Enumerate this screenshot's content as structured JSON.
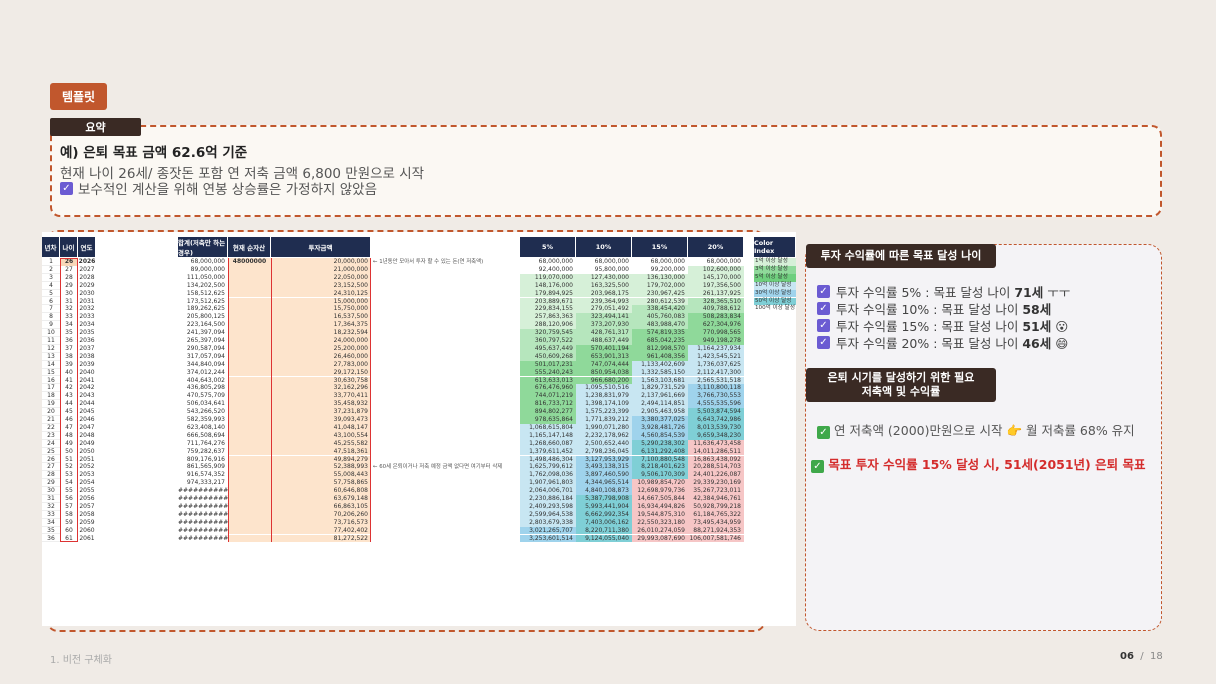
{
  "template_tag": "템플릿",
  "summary": {
    "tab": "요약",
    "line1": "예) 은퇴 목표 금액 62.6억 기준",
    "line2": "현재 나이 26세/ 종잣돈 포함 연 저축 금액 6,800 만원으로 시작",
    "line3": "보수적인 계산을 위해 연봉 상승률은 가정하지 않았음"
  },
  "sheet": {
    "headers": {
      "year_no": "년차",
      "age": "나이",
      "year": "연도",
      "total": "합계(저축만 하는 경우)",
      "current": "현재 순자산",
      "invest": "투자금액",
      "r5": "5%",
      "r10": "10%",
      "r15": "15%",
      "r20": "20%",
      "color_index": "Color Index"
    },
    "first_current": "48000000",
    "note1": "← 1년동안 모아서 투자 할 수 있는 돈(연 저축액)",
    "note2": "← 60세 은퇴이거나 저축 예정 금액 없다면 여기부터 삭제",
    "color_index": [
      "1억 이상 달성",
      "3억 이상 달성",
      "5억 이상 달성",
      "10억 이상 달성",
      "30억 이상 달성",
      "50억 이상 달성",
      "100억 이상 달성"
    ],
    "total_col": [
      "68,000,000",
      "89,000,000",
      "111,050,000",
      "134,202,500",
      "158,512,625",
      "173,512,625",
      "189,262,625",
      "205,800,125",
      "223,164,500",
      "241,397,094",
      "265,397,094",
      "290,587,094",
      "317,057,094",
      "344,840,094",
      "374,012,244",
      "404,643,002",
      "436,805,298",
      "470,575,709",
      "506,034,641",
      "543,266,520",
      "582,359,993",
      "623,408,140",
      "666,508,694",
      "711,764,276",
      "759,282,637",
      "809,176,916",
      "861,565,909",
      "916,574,352",
      "974,333,217",
      "##########",
      "##########",
      "##########",
      "##########",
      "##########",
      "##########",
      "##########"
    ],
    "invest_col": [
      "20,000,000",
      "21,000,000",
      "22,050,000",
      "23,152,500",
      "24,310,125",
      "15,000,000",
      "15,750,000",
      "16,537,500",
      "17,364,375",
      "18,232,594",
      "24,000,000",
      "25,200,000",
      "26,460,000",
      "27,783,000",
      "29,172,150",
      "30,630,758",
      "32,162,296",
      "33,770,411",
      "35,458,932",
      "37,231,879",
      "39,093,473",
      "41,048,147",
      "43,100,554",
      "45,255,582",
      "47,518,361",
      "49,894,279",
      "52,388,993",
      "55,008,443",
      "57,758,865",
      "60,646,808",
      "63,679,148",
      "66,863,105",
      "70,206,260",
      "73,716,573",
      "77,402,402",
      "81,272,522"
    ],
    "r5_col": [
      "68,000,000",
      "92,400,000",
      "119,070,000",
      "148,176,000",
      "179,894,925",
      "203,889,671",
      "229,834,155",
      "257,863,363",
      "288,120,906",
      "320,759,545",
      "360,797,522",
      "495,637,449",
      "450,609,268",
      "501,017,231",
      "555,240,243",
      "613,633,013",
      "676,476,960",
      "744,071,219",
      "816,733,712",
      "894,802,277",
      "978,635,864",
      "1,068,615,804",
      "1,165,147,148",
      "1,268,660,087",
      "1,379,611,452",
      "1,498,486,304",
      "1,625,799,612",
      "1,762,098,036",
      "1,907,961,803",
      "2,064,006,701",
      "2,230,886,184",
      "2,409,293,598",
      "2,599,964,538",
      "2,803,679,338",
      "3,021,265,707",
      "3,253,601,514"
    ],
    "r10_col": [
      "68,000,000",
      "95,800,000",
      "127,430,000",
      "163,325,500",
      "203,968,175",
      "239,364,993",
      "279,051,492",
      "323,494,141",
      "373,207,930",
      "428,761,317",
      "488,637,449",
      "570,401,194",
      "653,901,313",
      "747,074,444",
      "850,954,038",
      "966,680,200",
      "1,095,510,516",
      "1,238,831,979",
      "1,398,174,109",
      "1,575,223,399",
      "1,771,839,212",
      "1,990,071,280",
      "2,232,178,962",
      "2,500,652,440",
      "2,798,236,045",
      "3,127,953,929",
      "3,493,138,315",
      "3,897,460,590",
      "4,344,965,514",
      "4,840,108,873",
      "5,387,798,908",
      "5,993,441,904",
      "6,662,992,354",
      "7,403,006,162",
      "8,220,711,380",
      "9,124,055,040"
    ],
    "r15_col": [
      "68,000,000",
      "99,200,000",
      "136,130,000",
      "179,702,000",
      "230,967,425",
      "280,612,539",
      "338,454,420",
      "405,760,083",
      "483,988,470",
      "574,819,335",
      "685,042,235",
      "812,998,570",
      "961,408,356",
      "1,133,402,609",
      "1,332,585,150",
      "1,563,103,681",
      "1,829,731,529",
      "2,137,961,669",
      "2,494,114,851",
      "2,905,463,958",
      "3,380,377,025",
      "3,928,481,726",
      "4,560,854,539",
      "5,290,238,302",
      "6,131,292,408",
      "7,100,880,548",
      "8,218,401,623",
      "9,506,170,309",
      "10,989,854,720",
      "12,698,979,736",
      "14,667,505,844",
      "16,934,494,826",
      "19,544,875,310",
      "22,550,323,180",
      "26,010,274,059",
      "29,993,087,690"
    ],
    "r20_col": [
      "68,000,000",
      "102,600,000",
      "145,170,000",
      "197,356,500",
      "261,137,925",
      "328,365,510",
      "409,788,612",
      "508,283,834",
      "627,304,976",
      "770,998,565",
      "949,198,278",
      "1,164,237,934",
      "1,423,545,521",
      "1,736,037,625",
      "2,112,417,300",
      "2,565,531,518",
      "3,110,800,118",
      "3,766,730,553",
      "4,555,535,596",
      "5,503,874,594",
      "6,643,742,986",
      "8,013,539,730",
      "9,659,348,230",
      "11,636,473,458",
      "14,011,286,511",
      "16,863,438,092",
      "20,288,514,703",
      "24,401,226,087",
      "29,339,230,169",
      "35,267,723,011",
      "42,384,946,761",
      "50,928,799,218",
      "61,184,765,322",
      "73,495,434,959",
      "88,271,924,353",
      "106,007,581,746"
    ]
  },
  "panel": {
    "tag1": "투자 수익률에 따른 목표 달성 나이",
    "results": [
      {
        "label": "투자 수익률 5% : ",
        "text": "목표 달성 나이 ",
        "age": "71세",
        "suffix": " ㅜㅜ",
        "emoji": ""
      },
      {
        "label": "투자 수익률 10% : ",
        "text": "목표 달성 나이 ",
        "age": "58세",
        "suffix": "",
        "emoji": ""
      },
      {
        "label": "투자 수익률 15% : ",
        "text": "목표 달성 나이 ",
        "age": "51세",
        "suffix": "",
        "emoji": "😮"
      },
      {
        "label": "투자 수익률 20% : ",
        "text": "목표 달성 나이 ",
        "age": "46세",
        "suffix": "",
        "emoji": "😄"
      }
    ],
    "tag2_line1": "은퇴 시기를 달성하기 위한 필요",
    "tag2_line2": "저축액 및 수익률",
    "goal1": "연 저축액 (2000)만원으로 시작 👉 월 저축률 68% 유지",
    "goal2": "목표 투자 수익률 15% 달성 시, 51세(2051년) 은퇴 목표"
  },
  "footer": {
    "section": "1. 비전 구체화",
    "page": "06",
    "total": "18"
  },
  "colors": {
    "accent": "#c1572d",
    "dark": "#3a2a24",
    "header_navy": "#1f2d50",
    "green_light": "#d6f0d8",
    "green_mid": "#8fd99a",
    "teal": "#7fcfd6",
    "blue": "#9fd3ec",
    "red_light": "#f6c6c6",
    "orange_light": "#fde4cc"
  }
}
